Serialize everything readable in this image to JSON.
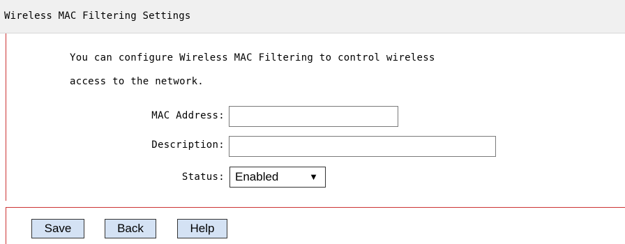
{
  "header": {
    "title": "Wireless MAC Filtering Settings"
  },
  "intro": {
    "line1": "You can configure Wireless MAC Filtering to control wireless",
    "line2": "access to the network."
  },
  "form": {
    "mac_label": "MAC Address:",
    "mac_value": "",
    "description_label": "Description:",
    "description_value": "",
    "status_label": "Status:",
    "status_value": "Enabled",
    "status_arrow": "▼"
  },
  "buttons": {
    "save": "Save",
    "back": "Back",
    "help": "Help"
  },
  "colors": {
    "accent_border": "#cc3333",
    "title_bg": "#f0f0f0",
    "button_bg": "#d4e2f4"
  }
}
